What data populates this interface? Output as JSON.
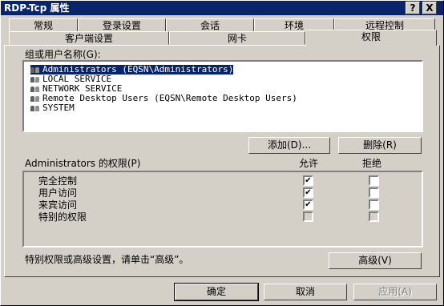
{
  "window": {
    "title": "RDP-Tcp 属性"
  },
  "titlebar_buttons": {
    "help": "?",
    "close": "X"
  },
  "tabs_back": [
    "常规",
    "登录设置",
    "会话",
    "环境",
    "远程控制"
  ],
  "tabs_front": [
    "客户端设置",
    "网卡",
    "权限"
  ],
  "groups": {
    "label": "组或用户名称(G):",
    "items": [
      "Administrators (EQSN\\Administrators)",
      "LOCAL SERVICE",
      "NETWORK SERVICE",
      "Remote Desktop Users (EQSN\\Remote Desktop Users)",
      "SYSTEM"
    ]
  },
  "buttons": {
    "add": "添加(D)...",
    "remove": "删除(R)",
    "advanced": "高级(V)",
    "ok": "确定",
    "cancel": "取消",
    "apply": "应用(A)"
  },
  "permissions": {
    "label": "Administrators 的权限(P)",
    "col_allow": "允许",
    "col_deny": "拒绝",
    "rows": [
      {
        "name": "完全控制",
        "allow": true,
        "deny": false
      },
      {
        "name": "用户访问",
        "allow": true,
        "deny": false
      },
      {
        "name": "来宾访问",
        "allow": true,
        "deny": false
      },
      {
        "name": "特别的权限",
        "allow": false,
        "deny": false
      }
    ]
  },
  "advanced_note": "特别权限或高级设置，请单击“高级”。"
}
